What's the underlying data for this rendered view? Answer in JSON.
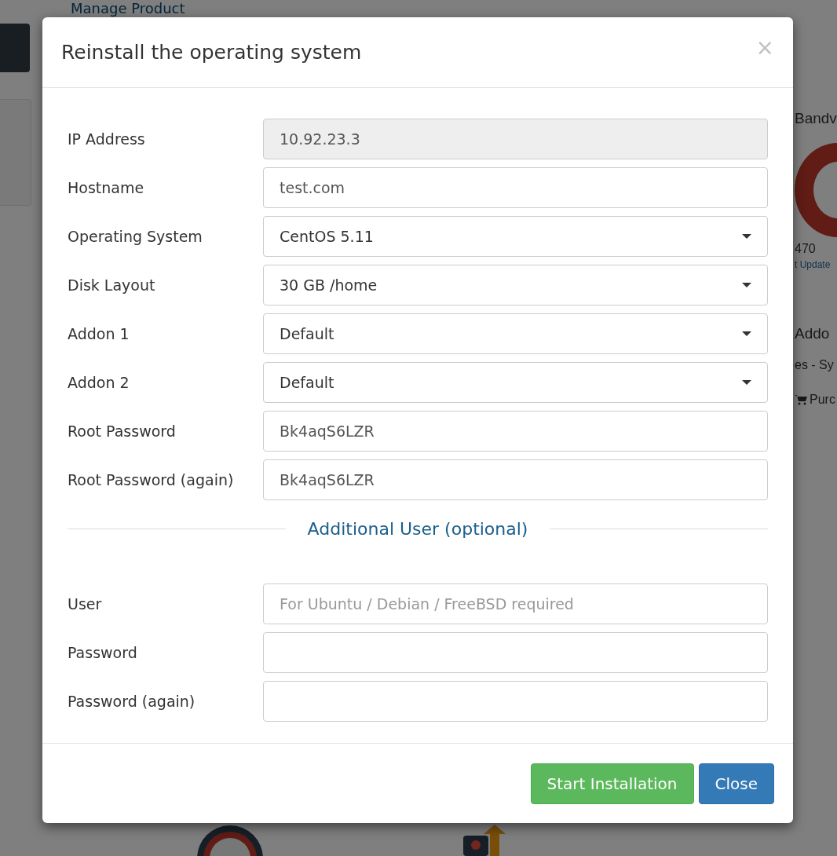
{
  "background": {
    "page_title": "Manage Product",
    "side_texts": [
      {
        "text": "Bandv",
        "kind": "heading"
      },
      {
        "text": "470",
        "kind": "value"
      },
      {
        "text": "t Update",
        "kind": "link"
      },
      {
        "text": "Addo",
        "kind": "heading"
      },
      {
        "text": "es - Sy",
        "kind": "item"
      },
      {
        "text": "Purc",
        "kind": "cart"
      }
    ]
  },
  "modal": {
    "title": "Reinstall the operating system",
    "close": "×",
    "fields": [
      {
        "label": "IP Address",
        "kind": "readonly",
        "value": "10.92.23.3"
      },
      {
        "label": "Hostname",
        "kind": "text",
        "value": "test.com"
      },
      {
        "label": "Operating System",
        "kind": "select",
        "value": "CentOS 5.11"
      },
      {
        "label": "Disk Layout",
        "kind": "select",
        "value": "30 GB /home"
      },
      {
        "label": "Addon 1",
        "kind": "select",
        "value": "Default"
      },
      {
        "label": "Addon 2",
        "kind": "select",
        "value": "Default"
      },
      {
        "label": "Root Password",
        "kind": "text",
        "value": "Bk4aqS6LZR"
      },
      {
        "label": "Root Password (again)",
        "kind": "text",
        "value": "Bk4aqS6LZR"
      }
    ],
    "section_title": "Additional User (optional)",
    "user_fields": [
      {
        "label": "User",
        "placeholder": "For Ubuntu / Debian / FreeBSD required"
      },
      {
        "label": "Password"
      },
      {
        "label": "Password (again)"
      }
    ],
    "buttons": [
      {
        "label": "Start Installation",
        "kind": "success"
      },
      {
        "label": "Close",
        "kind": "primary"
      }
    ]
  }
}
